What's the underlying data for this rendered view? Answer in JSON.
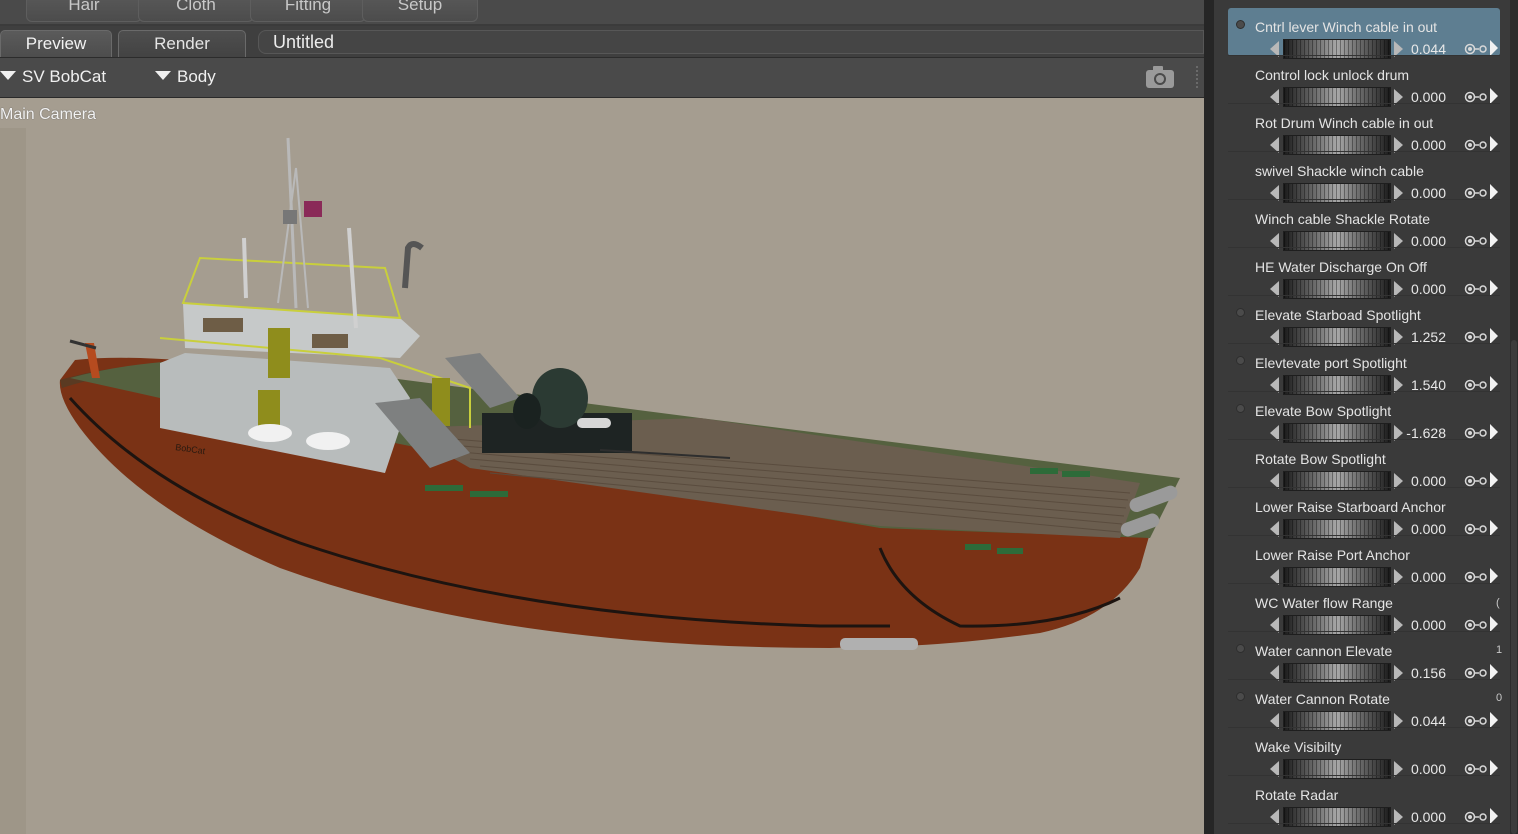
{
  "rooms": [
    "Hair",
    "Cloth",
    "Fitting",
    "Setup"
  ],
  "doc_tabs": [
    "Preview",
    "Render"
  ],
  "document_title": "Untitled",
  "scene": {
    "figure": "SV BobCat",
    "actor": "Body"
  },
  "viewport": {
    "camera": "Main Camera",
    "hull_name": "BobCat"
  },
  "colors": {
    "viewport_bg": "#a59d90",
    "selected_row": "#5e7e91",
    "hull": "#7a3215",
    "deck": "#6b5e4f"
  },
  "params": [
    {
      "label": "Cntrl lever Winch cable in out",
      "value": "0.044",
      "selected": true,
      "dot": true
    },
    {
      "label": "Control lock unlock drum",
      "value": "0.000"
    },
    {
      "label": "Rot Drum Winch cable in out",
      "value": "0.000"
    },
    {
      "label": "swivel Shackle winch cable",
      "value": "0.000"
    },
    {
      "label": "Winch cable Shackle Rotate",
      "value": "0.000"
    },
    {
      "label": "HE Water Discharge On Off",
      "value": "0.000"
    },
    {
      "label": "Elevate Starboad Spotlight",
      "value": "1.252",
      "dot": true
    },
    {
      "label": "Elevtevate port Spotlight",
      "value": "1.540",
      "dot": true
    },
    {
      "label": "Elevate Bow Spotlight",
      "value": "-1.628",
      "dot": true
    },
    {
      "label": "Rotate Bow Spotlight",
      "value": "0.000"
    },
    {
      "label": "Lower Raise Starboard Anchor",
      "value": "0.000"
    },
    {
      "label": "Lower Raise Port Anchor",
      "value": "0.000"
    },
    {
      "label": "WC Water flow Range",
      "value": "0.000"
    },
    {
      "label": "Water cannon Elevate",
      "value": "0.156",
      "dot": true
    },
    {
      "label": "Water Cannon Rotate",
      "value": "0.044",
      "dot": true
    },
    {
      "label": "Wake Visibilty",
      "value": "0.000"
    },
    {
      "label": "Rotate Radar",
      "value": "0.000"
    }
  ],
  "edge_glyphs": [
    "(",
    "1",
    "0"
  ],
  "icons": {
    "camera": "camera-icon",
    "key": "key-link-icon"
  }
}
